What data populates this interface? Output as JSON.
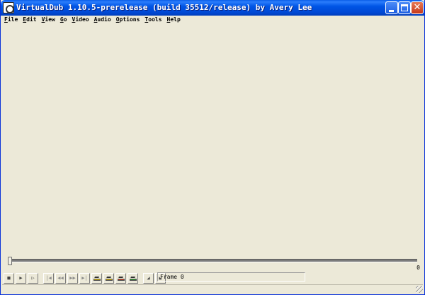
{
  "window": {
    "title": "VirtualDub 1.10.5-prerelease (build 35512/release) by Avery Lee",
    "controls": {
      "minimize_icon": "minimize-icon",
      "maximize_icon": "maximize-icon",
      "close_icon": "close-icon"
    }
  },
  "menu": [
    {
      "mnemonic": "F",
      "rest": "ile"
    },
    {
      "mnemonic": "E",
      "rest": "dit"
    },
    {
      "mnemonic": "V",
      "rest": "iew"
    },
    {
      "mnemonic": "G",
      "rest": "o"
    },
    {
      "mnemonic": "V",
      "rest": "ideo"
    },
    {
      "mnemonic": "A",
      "rest": "udio"
    },
    {
      "mnemonic": "O",
      "rest": "ptions"
    },
    {
      "mnemonic": "T",
      "rest": "ools"
    },
    {
      "mnemonic": "H",
      "rest": "elp"
    }
  ],
  "timeline": {
    "position": 0,
    "end_label": "0"
  },
  "toolbar": {
    "frame_label": "Frame 0"
  },
  "colors": {
    "titlebar": "#0055e5",
    "face": "#ece9d8"
  }
}
